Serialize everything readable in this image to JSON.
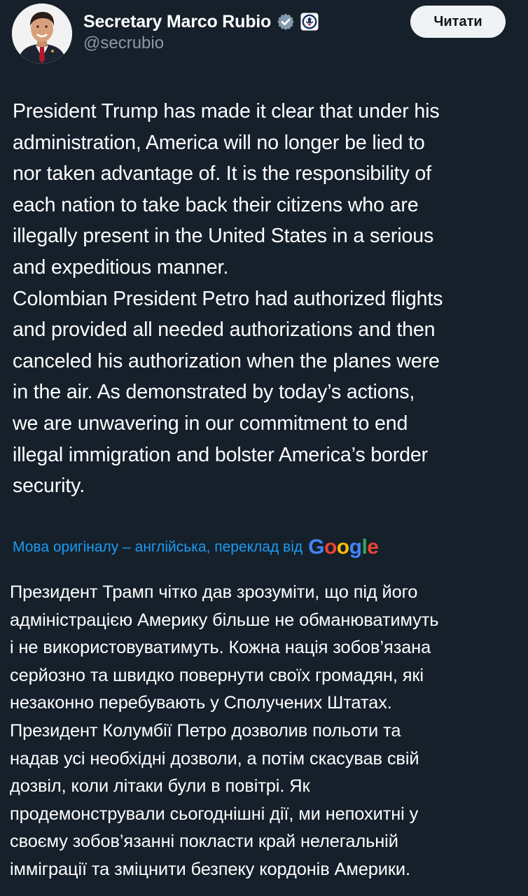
{
  "header": {
    "display_name": "Secretary Marco Rubio",
    "handle": "@secrubio",
    "follow_label": "Читати",
    "badge_icon": "verified-badge-icon",
    "affiliation_icon": "state-department-seal-icon"
  },
  "tweet": {
    "original_text": "President Trump has made it clear that under his\nadministration, America will no longer be lied to\nnor taken advantage of. It is the responsibility of\neach nation to take back their citizens who are\nillegally present in the United States in a serious\nand expeditious manner.\nColombian President Petro had authorized flights\nand provided all needed authorizations and then\ncanceled his authorization when the planes were\nin the air. As demonstrated by today’s actions,\nwe are unwavering in our commitment to end\nillegal immigration and bolster America’s border\nsecurity.",
    "translation_note": "Мова оригіналу – англійська, переклад від",
    "translator_logo_text": "Google",
    "translated_text": "Президент Трамп чітко дав зрозуміти, що під його\nадміністрацією Америку більше не обманюватимуть\nі не використовуватимуть. Кожна нація зобов’язана\nсерйозно та швидко повернути своїх громадян, які\nнезаконно перебувають у Сполучених Штатах.\nПрезидент Колумбії Петро дозволив польоти та\nнадав усі необхідні дозволи, а потім скасував свій\nдозвіл, коли літаки були в повітрі. Як\nпродемонстрували сьогоднішні дії, ми непохитні у\nсвоєму зобов’язанні покласти край нелегальній\nімміграції та зміцнити безпеку кордонів Америки."
  },
  "colors": {
    "background": "#15202b",
    "text_primary": "#ffffff",
    "text_secondary": "#8b98a5",
    "link_blue": "#1d9bf0",
    "button_bg": "#eff3f4",
    "button_text": "#0f1419",
    "verified_badge": "#829aab"
  }
}
